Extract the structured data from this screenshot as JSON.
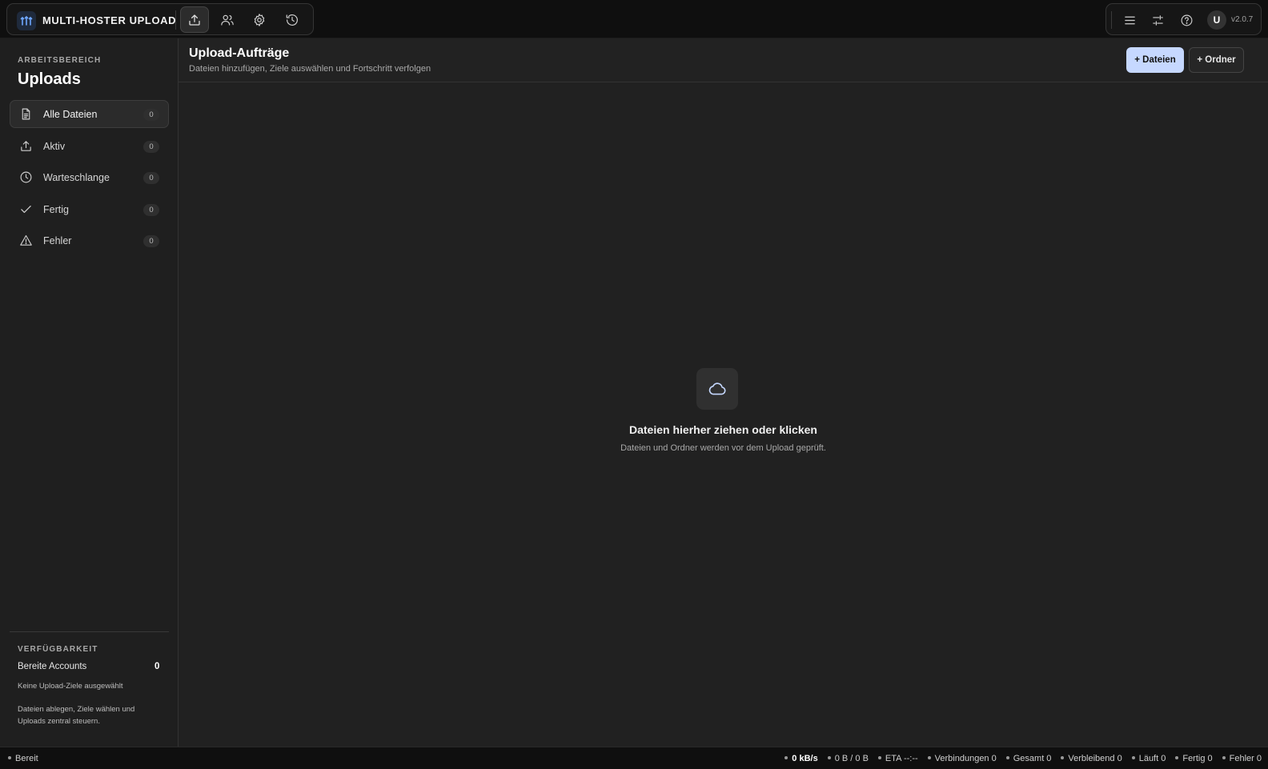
{
  "app": {
    "title": "MULTI-HOSTER UPLOAD",
    "version": "v2.0.7",
    "avatar_initial": "U",
    "accent_color": "#c6d8ff"
  },
  "topnav": {
    "items": [
      {
        "icon": "upload-icon",
        "active": true
      },
      {
        "icon": "users-icon",
        "active": false
      },
      {
        "icon": "gear-icon",
        "active": false
      },
      {
        "icon": "history-icon",
        "active": false
      }
    ],
    "right_icons": [
      "menu-icon",
      "sliders-icon",
      "help-icon"
    ]
  },
  "sidebar": {
    "eyebrow": "ARBEITSBEREICH",
    "title": "Uploads",
    "items": [
      {
        "label": "Alle Dateien",
        "count": "0",
        "icon": "file-icon",
        "active": true
      },
      {
        "label": "Aktiv",
        "count": "0",
        "icon": "upload-icon",
        "active": false
      },
      {
        "label": "Warteschlange",
        "count": "0",
        "icon": "clock-icon",
        "active": false
      },
      {
        "label": "Fertig",
        "count": "0",
        "icon": "check-icon",
        "active": false
      },
      {
        "label": "Fehler",
        "count": "0",
        "icon": "warning-icon",
        "active": false
      }
    ],
    "availability": {
      "eyebrow": "VERFÜGBARKEIT",
      "accounts_label": "Bereite Accounts",
      "accounts_value": "0",
      "no_targets": "Keine Upload-Ziele ausgewählt",
      "hint": "Dateien ablegen, Ziele wählen und Uploads zentral steuern."
    }
  },
  "main": {
    "title": "Upload-Aufträge",
    "subtitle": "Dateien hinzufügen, Ziele auswählen und Fortschritt verfolgen",
    "add_files_label": "+ Dateien",
    "add_folder_label": "+ Ordner",
    "dropzone": {
      "icon": "cloud-icon",
      "title": "Dateien hierher ziehen oder klicken",
      "subtitle": "Dateien und Ordner werden vor dem Upload geprüft."
    }
  },
  "statusbar": {
    "state": "Bereit",
    "speed": "0 kB/s",
    "transferred": "0 B / 0 B",
    "eta": "ETA --:--",
    "connections": "Verbindungen 0",
    "total": "Gesamt 0",
    "remaining": "Verbleibend 0",
    "running": "Läuft 0",
    "done": "Fertig 0",
    "errors": "Fehler 0"
  }
}
